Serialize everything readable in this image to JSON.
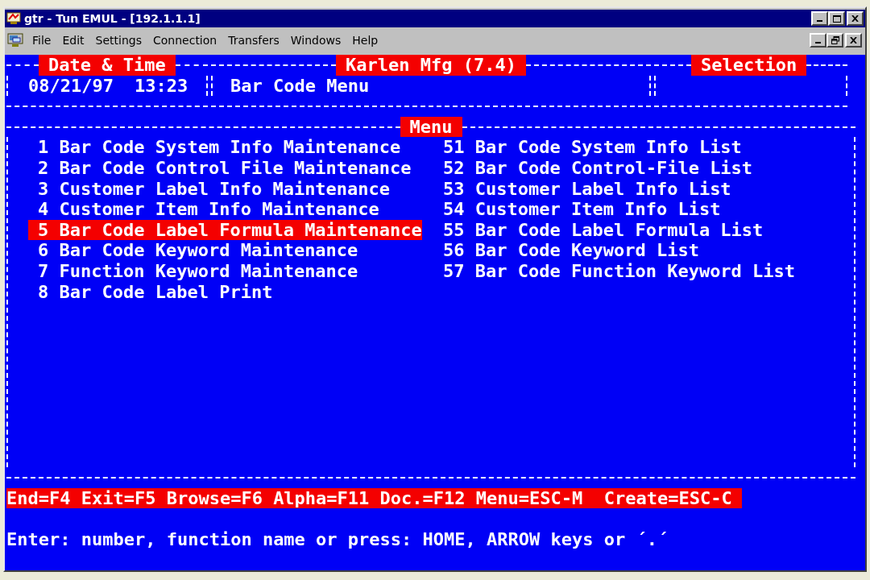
{
  "window": {
    "title": "gtr - Tun EMUL - [192.1.1.1]"
  },
  "menu_bar": [
    {
      "label": "File"
    },
    {
      "label": "Edit"
    },
    {
      "label": "Settings"
    },
    {
      "label": "Connection"
    },
    {
      "label": "Transfers"
    },
    {
      "label": "Windows"
    },
    {
      "label": "Help"
    }
  ],
  "header": {
    "date_time": {
      "title": "Date & Time",
      "date": "08/21/97",
      "time": "13:23"
    },
    "main": {
      "title": "Karlen Mfg (7.4)",
      "text": "Bar Code Menu"
    },
    "selection": {
      "title": "Selection"
    }
  },
  "menu": {
    "title": "Menu",
    "columns": [
      {
        "items": [
          {
            "number": "1",
            "label": "Bar Code System Info Maintenance",
            "selected": false
          },
          {
            "number": "2",
            "label": "Bar Code Control File Maintenance",
            "selected": false
          },
          {
            "number": "3",
            "label": "Customer Label Info Maintenance",
            "selected": false
          },
          {
            "number": "4",
            "label": "Customer Item Info Maintenance",
            "selected": false
          },
          {
            "number": "5",
            "label": "Bar Code Label Formula Maintenance",
            "selected": true
          },
          {
            "number": "6",
            "label": "Bar Code Keyword Maintenance",
            "selected": false
          },
          {
            "number": "7",
            "label": "Function Keyword Maintenance",
            "selected": false
          },
          {
            "number": "8",
            "label": "Bar Code Label Print",
            "selected": false
          }
        ]
      },
      {
        "items": [
          {
            "number": "51",
            "label": "Bar Code System Info List",
            "selected": false
          },
          {
            "number": "52",
            "label": "Bar Code Control-File List",
            "selected": false
          },
          {
            "number": "53",
            "label": "Customer Label Info List",
            "selected": false
          },
          {
            "number": "54",
            "label": "Customer Item Info List",
            "selected": false
          },
          {
            "number": "55",
            "label": "Bar Code Label Formula List",
            "selected": false
          },
          {
            "number": "56",
            "label": "Bar Code Keyword List",
            "selected": false
          },
          {
            "number": "57",
            "label": "Bar Code Function Keyword List",
            "selected": false
          }
        ]
      }
    ]
  },
  "function_keys": "End=F4 Exit=F5 Browse=F6 Alpha=F11 Doc.=F12 Menu=ESC-M  Create=ESC-C",
  "prompt": "Enter: number, function name or press: HOME, ARROW keys or ´.´"
}
